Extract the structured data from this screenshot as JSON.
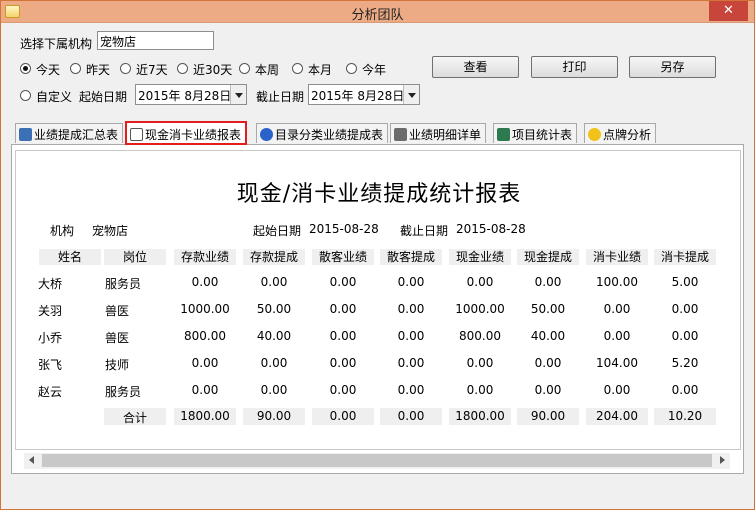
{
  "window": {
    "title": "分析团队",
    "close_glyph": "✕"
  },
  "filter": {
    "org_label": "选择下属机构",
    "org_value": "宠物店",
    "ranges": [
      {
        "label": "今天",
        "selected": true
      },
      {
        "label": "昨天",
        "selected": false
      },
      {
        "label": "近7天",
        "selected": false
      },
      {
        "label": "近30天",
        "selected": false
      },
      {
        "label": "本周",
        "selected": false
      },
      {
        "label": "本月",
        "selected": false
      },
      {
        "label": "今年",
        "selected": false
      }
    ],
    "custom_label": "自定义",
    "start_label": "起始日期",
    "start_value": "2015年 8月28日",
    "end_label": "截止日期",
    "end_value": "2015年 8月28日"
  },
  "buttons": {
    "query": "查看",
    "print": "打印",
    "save_as": "另存"
  },
  "tabs": [
    {
      "label": "业绩提成汇总表",
      "icon": "summary-icon",
      "color": "#3b6fb6"
    },
    {
      "label": "现金消卡业绩报表",
      "icon": "report-icon",
      "color": "#555555",
      "active": true
    },
    {
      "label": "目录分类业绩提成表",
      "icon": "info-icon",
      "color": "#2a62c9"
    },
    {
      "label": "业绩明细详单",
      "icon": "tools-icon",
      "color": "#6b6b6b"
    },
    {
      "label": "项目统计表",
      "icon": "sheet-icon",
      "color": "#2d7a4e"
    },
    {
      "label": "点牌分析",
      "icon": "smiley-icon",
      "color": "#f2c21a"
    }
  ],
  "report": {
    "title": "现金/消卡业绩提成统计报表",
    "org_label": "机构",
    "org_value": "宠物店",
    "start_label": "起始日期",
    "start_value": "2015-08-28",
    "end_label": "截止日期",
    "end_value": "2015-08-28",
    "columns": [
      "姓名",
      "岗位",
      "存款业绩",
      "存款提成",
      "散客业绩",
      "散客提成",
      "现金业绩",
      "现金提成",
      "消卡业绩",
      "消卡提成"
    ],
    "rows": [
      [
        "大桥",
        "服务员",
        "0.00",
        "0.00",
        "0.00",
        "0.00",
        "0.00",
        "0.00",
        "100.00",
        "5.00"
      ],
      [
        "关羽",
        "兽医",
        "1000.00",
        "50.00",
        "0.00",
        "0.00",
        "1000.00",
        "50.00",
        "0.00",
        "0.00"
      ],
      [
        "小乔",
        "兽医",
        "800.00",
        "40.00",
        "0.00",
        "0.00",
        "800.00",
        "40.00",
        "0.00",
        "0.00"
      ],
      [
        "张飞",
        "技师",
        "0.00",
        "0.00",
        "0.00",
        "0.00",
        "0.00",
        "0.00",
        "104.00",
        "5.20"
      ],
      [
        "赵云",
        "服务员",
        "0.00",
        "0.00",
        "0.00",
        "0.00",
        "0.00",
        "0.00",
        "0.00",
        "0.00"
      ]
    ],
    "total_label": "合计",
    "totals": [
      "1800.00",
      "90.00",
      "0.00",
      "0.00",
      "1800.00",
      "90.00",
      "204.00",
      "10.20"
    ]
  },
  "colors": {
    "titlebar": "#ecab85",
    "active_tab_border": "#e11d1d",
    "close": "#c7453a"
  }
}
